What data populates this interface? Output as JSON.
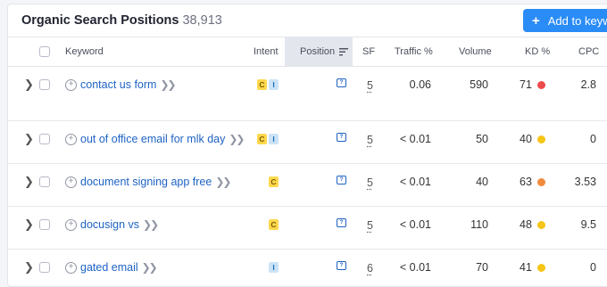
{
  "header": {
    "title": "Organic Search Positions",
    "count": "38,913",
    "add_button": "Add to keyw"
  },
  "columns": {
    "keyword": "Keyword",
    "intent": "Intent",
    "position": "Position",
    "sf": "SF",
    "traffic": "Traffic %",
    "volume": "Volume",
    "kd": "KD %",
    "cpc": "CPC"
  },
  "colors": {
    "accent": "#2a8cf7",
    "kd_red": "#ee4b4b",
    "kd_yellow": "#f5c518",
    "kd_orange": "#f08a3c"
  },
  "rows": [
    {
      "keyword": "contact us form",
      "intents": [
        "C",
        "I"
      ],
      "sf": "5",
      "traffic": "0.06",
      "volume": "590",
      "kd": "71",
      "kd_color": "#ee4b4b",
      "cpc": "2.8"
    },
    {
      "keyword": "out of office email for mlk day",
      "intents": [
        "C",
        "I"
      ],
      "sf": "5",
      "traffic": "< 0.01",
      "volume": "50",
      "kd": "40",
      "kd_color": "#f5c518",
      "cpc": "0"
    },
    {
      "keyword": "document signing app free",
      "intents": [
        "C"
      ],
      "sf": "5",
      "traffic": "< 0.01",
      "volume": "40",
      "kd": "63",
      "kd_color": "#f08a3c",
      "cpc": "3.53"
    },
    {
      "keyword": "docusign vs",
      "intents": [
        "C"
      ],
      "sf": "5",
      "traffic": "< 0.01",
      "volume": "110",
      "kd": "48",
      "kd_color": "#f5c518",
      "cpc": "9.5"
    },
    {
      "keyword": "gated email",
      "intents": [
        "I"
      ],
      "sf": "6",
      "traffic": "< 0.01",
      "volume": "70",
      "kd": "41",
      "kd_color": "#f5c518",
      "cpc": "0"
    }
  ]
}
